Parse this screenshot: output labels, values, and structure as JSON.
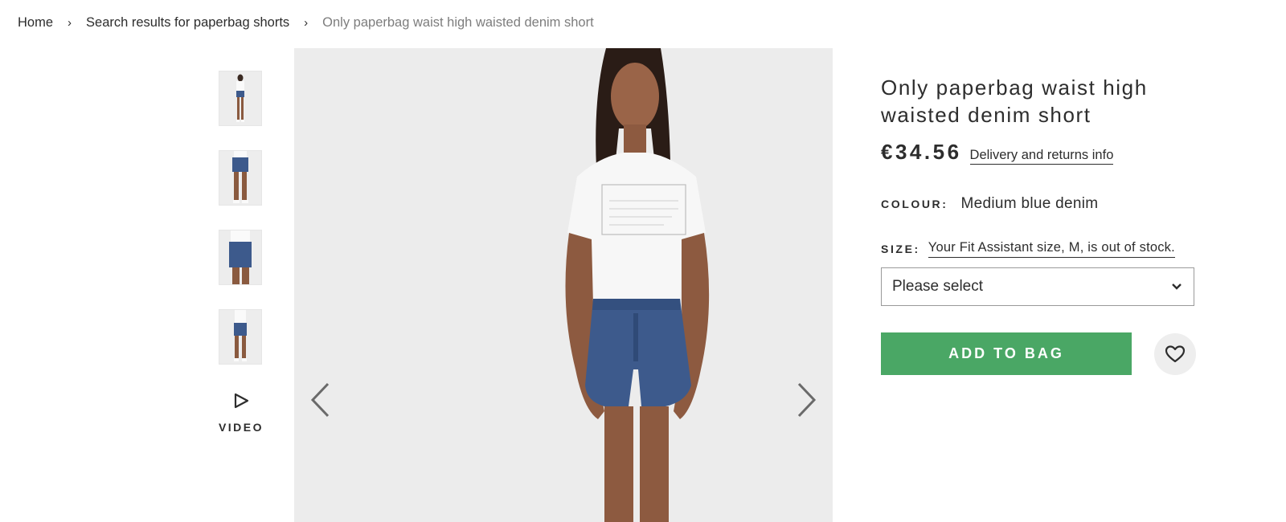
{
  "breadcrumb": {
    "items": [
      "Home",
      "Search results for paperbag shorts"
    ],
    "current": "Only paperbag waist high waisted denim short",
    "separator": "›"
  },
  "gallery": {
    "thumbnails": [
      "product-front",
      "product-back",
      "product-side",
      "product-detail"
    ],
    "video_label": "VIDEO"
  },
  "product": {
    "title": "Only paperbag waist high waisted denim short",
    "price": "€34.56",
    "delivery_link": "Delivery and returns info",
    "colour_label": "COLOUR:",
    "colour_value": "Medium blue denim",
    "size_label": "SIZE:",
    "fit_assistant_text": "Your Fit Assistant size, M, is out of stock.",
    "size_select": "Please select",
    "add_to_bag": "ADD TO BAG"
  },
  "colors": {
    "add_button": "#4aa765",
    "text": "#2d2d2d",
    "image_bg": "#ececec",
    "denim": "#3d5a8c"
  },
  "icons": {
    "prev": "chevron-left-icon",
    "next": "chevron-right-icon",
    "video": "play-icon",
    "select": "chevron-down-icon",
    "save": "heart-icon"
  }
}
